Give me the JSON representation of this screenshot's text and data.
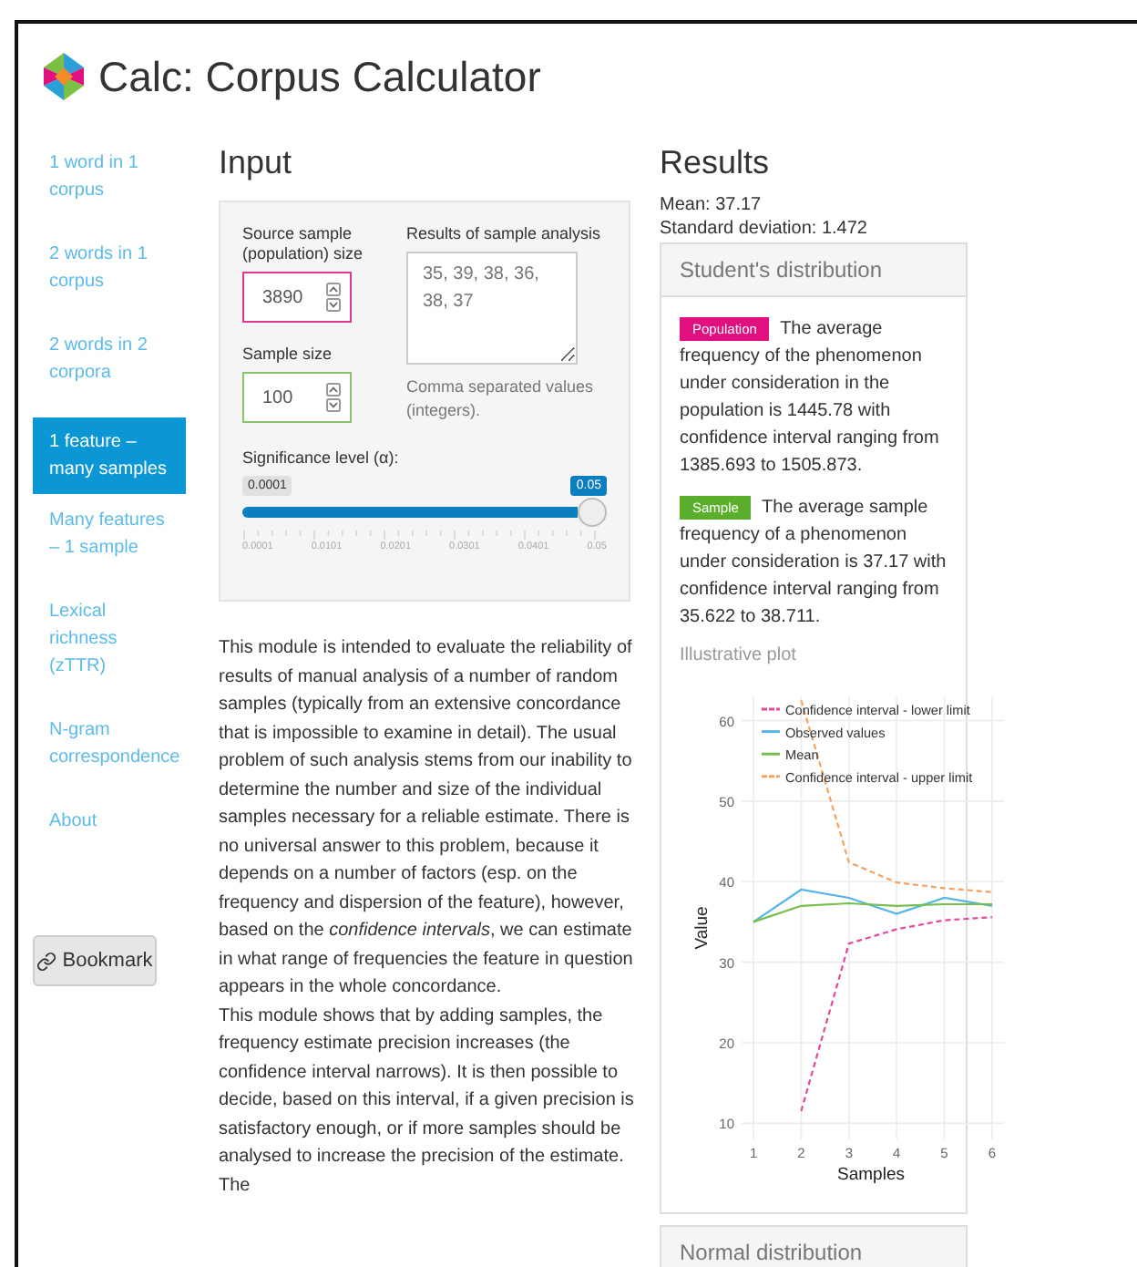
{
  "app": {
    "title": "Calc: Corpus Calculator"
  },
  "sidebar": {
    "items": [
      {
        "label": "1 word in 1 corpus",
        "selected": false
      },
      {
        "label": "2 words in 1 corpus",
        "selected": false
      },
      {
        "label": "2 words in 2 corpora",
        "selected": false
      },
      {
        "label": "1 feature – many samples",
        "selected": true
      },
      {
        "label": "Many features – 1 sample",
        "selected": false
      },
      {
        "label": "Lexical richness (zTTR)",
        "selected": false
      },
      {
        "label": "N-gram correspondence",
        "selected": false
      },
      {
        "label": "About",
        "selected": false
      }
    ],
    "bookmark": "Bookmark"
  },
  "input": {
    "heading": "Input",
    "fields": [
      {
        "label": "Source sample (population) size",
        "value": "3890",
        "color": "#e0388f"
      },
      {
        "label": "Sample size",
        "value": "100",
        "color": "#8cc26c"
      }
    ],
    "results_field": {
      "label": "Results of sample analysis",
      "value": "35, 39, 38, 36, 38, 37",
      "help": "Comma separated values (integers)."
    },
    "slider": {
      "label": "Significance level (α):",
      "min_label": "0.0001",
      "value_label": "0.05",
      "level": 1,
      "ticks": [
        "0.0001",
        "0.0101",
        "0.0201",
        "0.0301",
        "0.0401",
        "0.05"
      ]
    }
  },
  "description": [
    "This module is intended to evaluate the reliability of results of manual analysis of a number of random samples (typically from an extensive concordance that is impossible to examine in detail). The usual problem of such analysis stems from our inability to determine the number and size of the individual samples necessary for a reliable estimate. There is no universal answer to this problem, because it depends on a number of factors (esp. on the frequency and dispersion of the feature), however, based on the *confidence intervals*, we can estimate in what range of frequencies the feature in question appears in the whole concordance.",
    "This module shows that by adding samples, the frequency estimate precision increases (the confidence interval narrows). It is then possible to decide, based on this interval, if a given precision is satisfactory enough, or if more samples should be analysed to increase the precision of the estimate. The"
  ],
  "results": {
    "heading": "Results",
    "mean": "Mean: 37.17",
    "sd": "Standard deviation: 1.472",
    "panels": [
      {
        "title": "Student's distribution",
        "expanded": true,
        "statements": [
          {
            "badge": "Population",
            "color": "#e0107f",
            "text": "The average frequency of the phenomenon under consideration in the population is 1445.78 with confidence interval ranging from 1385.693 to 1505.873."
          },
          {
            "badge": "Sample",
            "color": "#5aae2b",
            "text": "The average sample frequency of a phenomenon under consideration is 37.17 with confidence interval ranging from 35.622 to 38.711."
          }
        ],
        "plot_title": "Illustrative plot",
        "chart_data": {
          "type": "line",
          "xlabel": "Samples",
          "ylabel": "Value",
          "x": [
            1,
            2,
            3,
            4,
            5,
            6
          ],
          "xlim": [
            0.75,
            6.25
          ],
          "ylim": [
            8,
            63
          ],
          "xticks": [
            1,
            2,
            3,
            4,
            5,
            6
          ],
          "yticks": [
            10,
            20,
            30,
            40,
            50,
            60
          ],
          "grid": true,
          "legend": true,
          "series": [
            {
              "name": "Confidence interval - lower limit",
              "color": "#e7479a",
              "line_style": "dashed",
              "values": [
                null,
                11.5,
                32.3,
                34.1,
                35.2,
                35.6
              ]
            },
            {
              "name": "Observed values",
              "color": "#56b4e9",
              "line_style": "solid",
              "values": [
                35,
                39,
                38,
                36,
                38,
                37
              ]
            },
            {
              "name": "Mean",
              "color": "#78be4e",
              "line_style": "solid",
              "values": [
                35,
                37,
                37.3,
                37,
                37.2,
                37.2
              ]
            },
            {
              "name": "Confidence interval - upper limit",
              "color": "#f4a261",
              "line_style": "dashed",
              "values": [
                null,
                62.5,
                42.4,
                39.9,
                39.2,
                38.7
              ]
            }
          ]
        }
      },
      {
        "title": "Normal distribution",
        "expanded": false
      }
    ]
  }
}
